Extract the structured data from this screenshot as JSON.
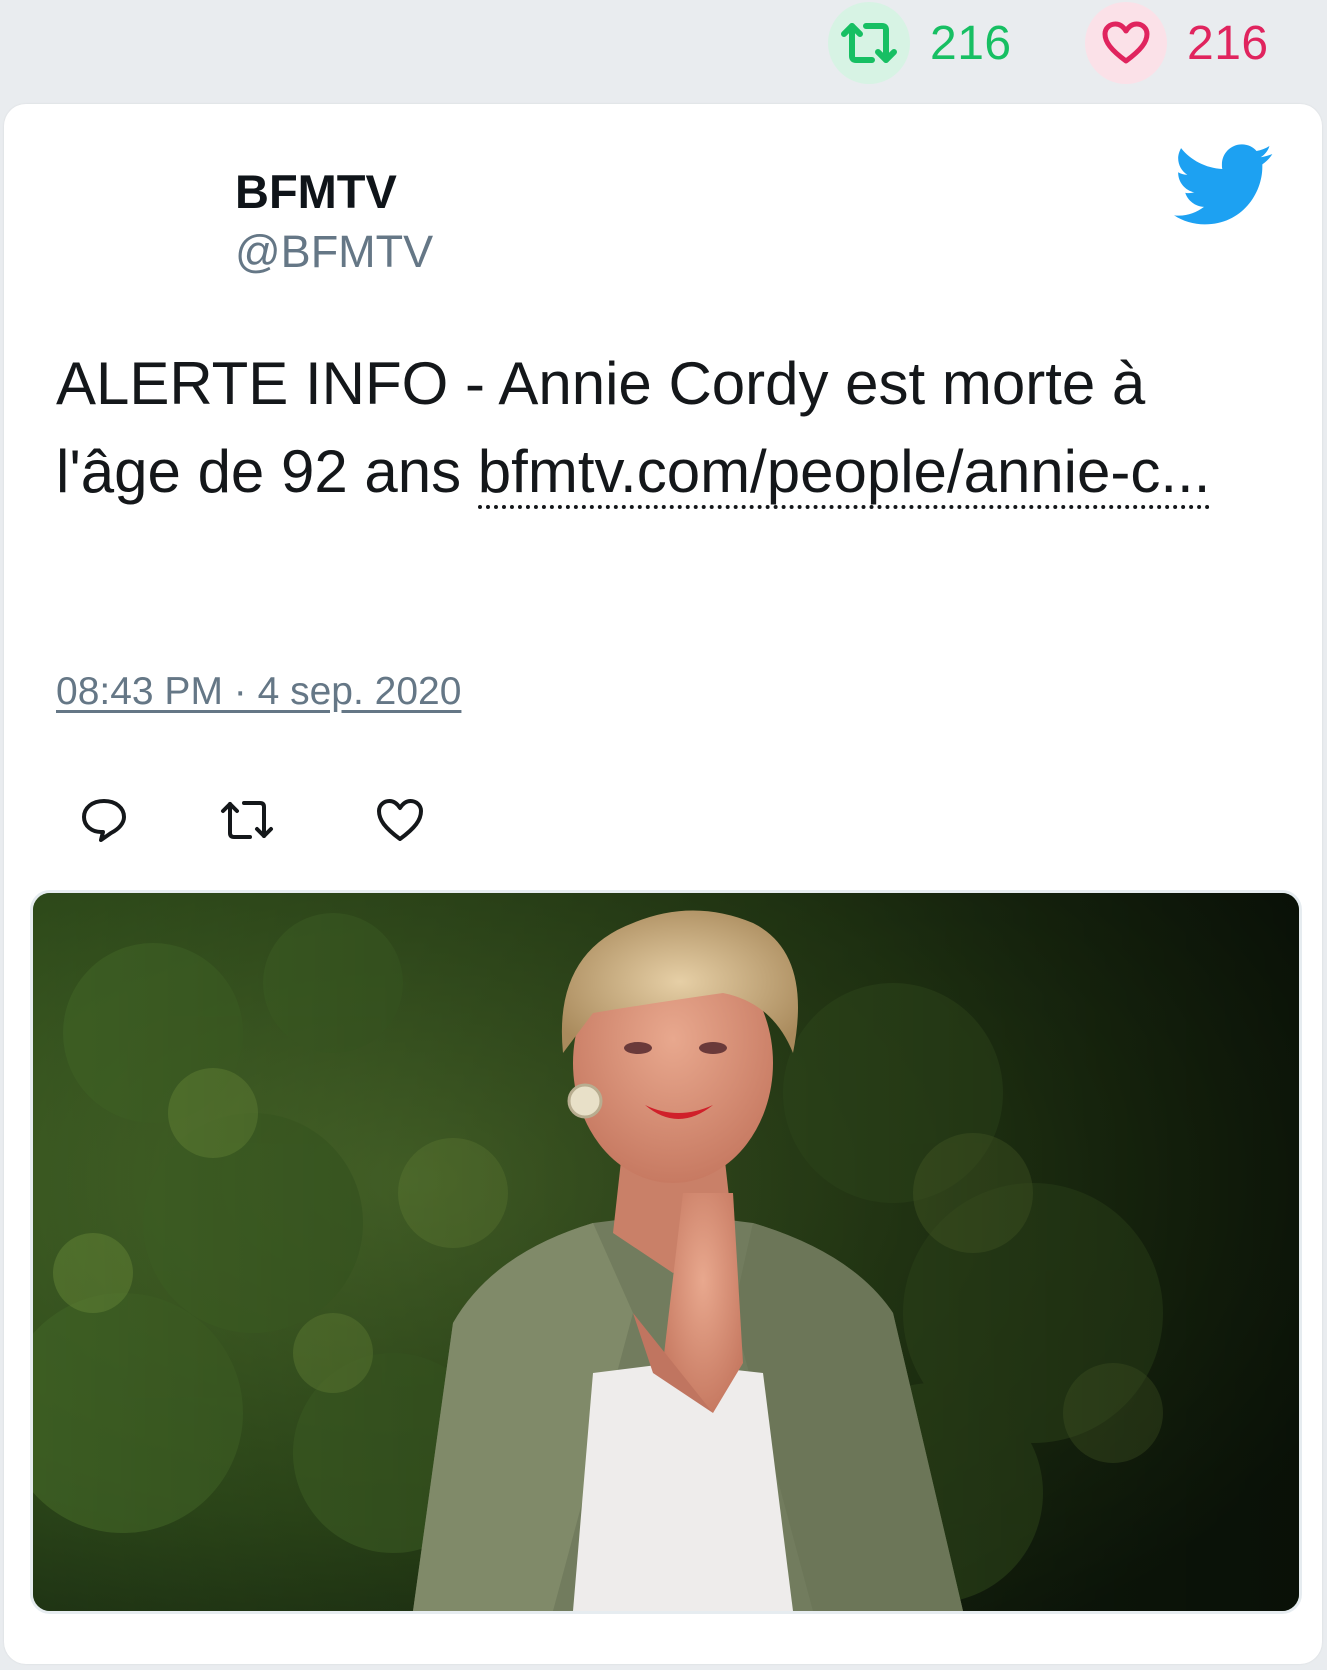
{
  "stats": {
    "retweets": "216",
    "likes": "216",
    "retweet_icon": "retweet-icon",
    "like_icon": "heart-icon",
    "retweet_color": "#17bf63",
    "like_color": "#e0245e"
  },
  "tweet": {
    "author_name": "BFMTV",
    "author_handle": "@BFMTV",
    "text": "ALERTE INFO - Annie Cordy est morte à l'âge de 92 ans ",
    "link_text": "bfmtv.com/people/annie-c...",
    "timestamp": "08:43 PM · 4 sep. 2020",
    "brand_color": "#1da1f2"
  },
  "actions": {
    "reply_icon": "reply-icon",
    "retweet_icon": "retweet-icon",
    "like_icon": "heart-icon"
  },
  "media": {
    "image_icon": "photo-of-smiling-elderly-woman-icon"
  }
}
